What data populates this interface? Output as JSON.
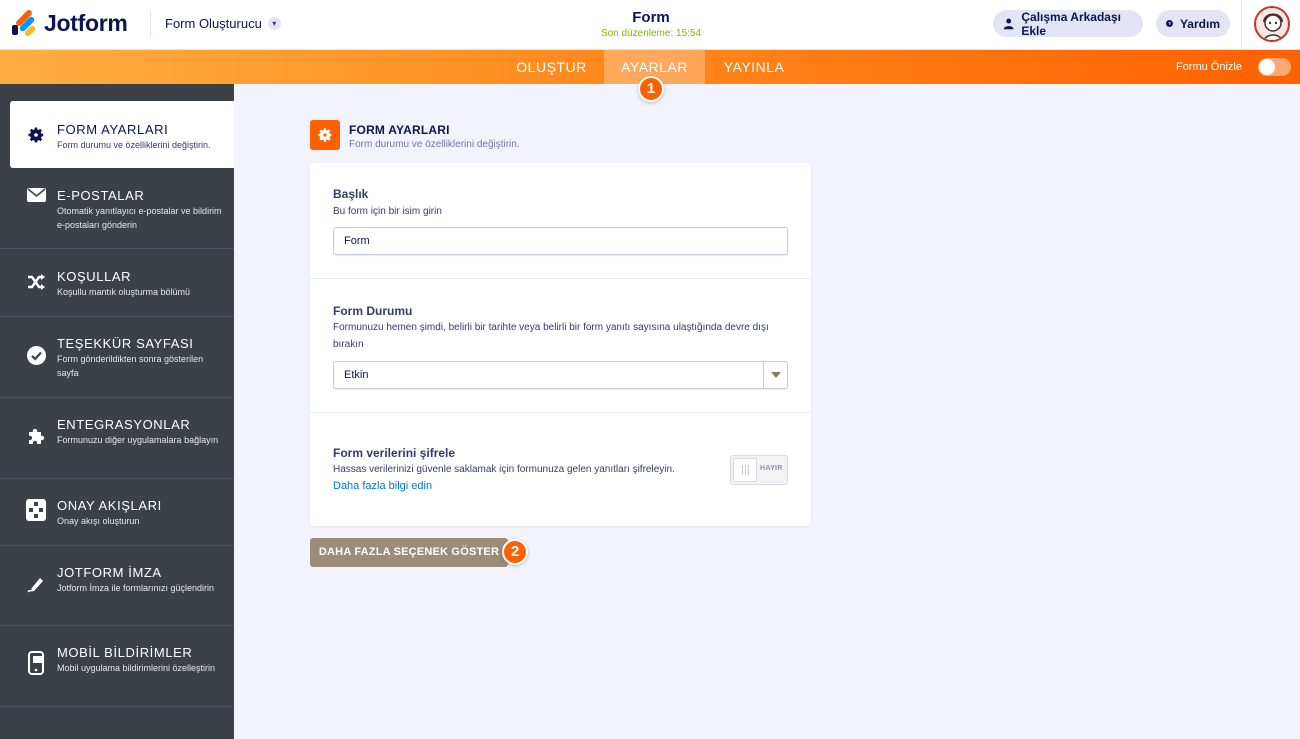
{
  "app": {
    "logo_text": "Jotform",
    "builder_label": "Form Oluşturucu",
    "form_title": "Form",
    "last_edit": "Son düzenleme: 15:54",
    "invite_label": "Çalışma Arkadaşı Ekle",
    "help_label": "Yardım",
    "accent_color": "#ff6100"
  },
  "nav": {
    "tabs": [
      {
        "label": "OLUŞTUR"
      },
      {
        "label": "AYARLAR",
        "active": true
      },
      {
        "label": "YAYINLA"
      }
    ],
    "preview_label": "Formu Önizle",
    "preview_enabled": false
  },
  "markers": [
    "1",
    "2"
  ],
  "sidebar": {
    "items": [
      {
        "title": "FORM AYARLARI",
        "desc": "Form durumu ve özelliklerini değiştirin.",
        "icon": "gear-icon",
        "active": true
      },
      {
        "title": "E-POSTALAR",
        "desc": "Otomatik yanıtlayıcı e-postalar ve bildirim e-postaları gönderin",
        "icon": "envelope-icon"
      },
      {
        "title": "KOŞULLAR",
        "desc": "Koşullu mantık oluşturma bölümü",
        "icon": "shuffle-icon"
      },
      {
        "title": "TEŞEKKÜR SAYFASI",
        "desc": "Form gönderildikten sonra gösterilen sayfa",
        "icon": "check-circle-icon"
      },
      {
        "title": "ENTEGRASYONLAR",
        "desc": "Formunuzu diğer uygulamalara bağlayın",
        "icon": "puzzle-icon"
      },
      {
        "title": "ONAY AKIŞLARI",
        "desc": "Onay akışı oluşturun",
        "icon": "flow-icon"
      },
      {
        "title": "JOTFORM İMZA",
        "desc": "Jotform İmza ile formlarınızı güçlendirin",
        "icon": "pen-icon"
      },
      {
        "title": "MOBİL BİLDİRİMLER",
        "desc": "Mobil uygulama bildirimlerini özelleştirin",
        "icon": "mobile-icon"
      }
    ]
  },
  "main": {
    "section_title": "FORM AYARLARI",
    "section_desc": "Form durumu ve özelliklerini değiştirin.",
    "title_field": {
      "label": "Başlık",
      "sub": "Bu form için bir isim girin",
      "value": "Form"
    },
    "status_field": {
      "label": "Form Durumu",
      "sub": "Formunuzu hemen şimdi, belirli bir tarihte veya belirli bir form yanıtı sayısına ulaştığında devre dışı bırakın",
      "value": "Etkin"
    },
    "encrypt_field": {
      "label": "Form verilerini şifrele",
      "sub": "Hassas verilerinizi güvenle saklamak için formunuza gelen yanıtları şifreleyin.",
      "link": "Daha fazla bilgi edin",
      "toggle_text": "HAYIR",
      "enabled": false
    },
    "more_button": "DAHA FAZLA SEÇENEK GÖSTER"
  }
}
